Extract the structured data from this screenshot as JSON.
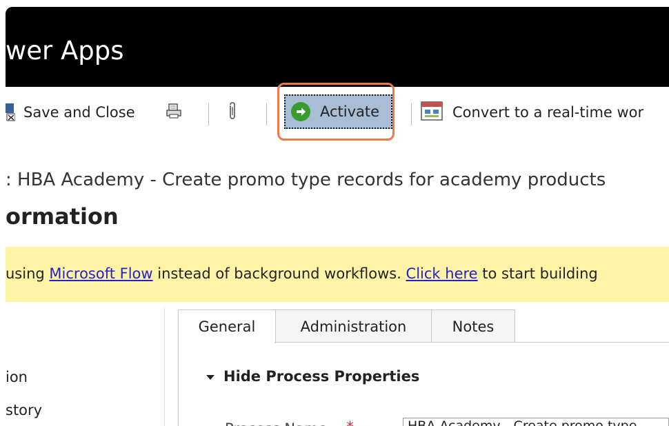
{
  "app": {
    "title": "wer Apps"
  },
  "toolbar": {
    "save_close_label": "Save and Close",
    "activate_label": "Activate",
    "convert_label": "Convert to a real-time wor"
  },
  "record": {
    "title": ": HBA Academy - Create promo type records for academy products",
    "section_heading": "ormation"
  },
  "banner": {
    "prefix": "using ",
    "link1": "Microsoft Flow",
    "middle": " instead of background workflows. ",
    "link2": "Click here",
    "suffix": " to start building"
  },
  "left_nav": {
    "items": [
      "ion",
      "story"
    ]
  },
  "tabs": [
    {
      "label": "General",
      "active": true
    },
    {
      "label": "Administration",
      "active": false
    },
    {
      "label": "Notes",
      "active": false
    }
  ],
  "general": {
    "section_toggle_label": "Hide Process Properties",
    "process_name_label": "Process Name",
    "process_name_value": "HBA Academy - Create promo type..."
  },
  "colors": {
    "topbar": "#000000",
    "highlight": "#ed7a4f",
    "activate_bg": "#a9bdd4",
    "banner_bg": "#fff3a6",
    "link": "#1f1fd6"
  }
}
